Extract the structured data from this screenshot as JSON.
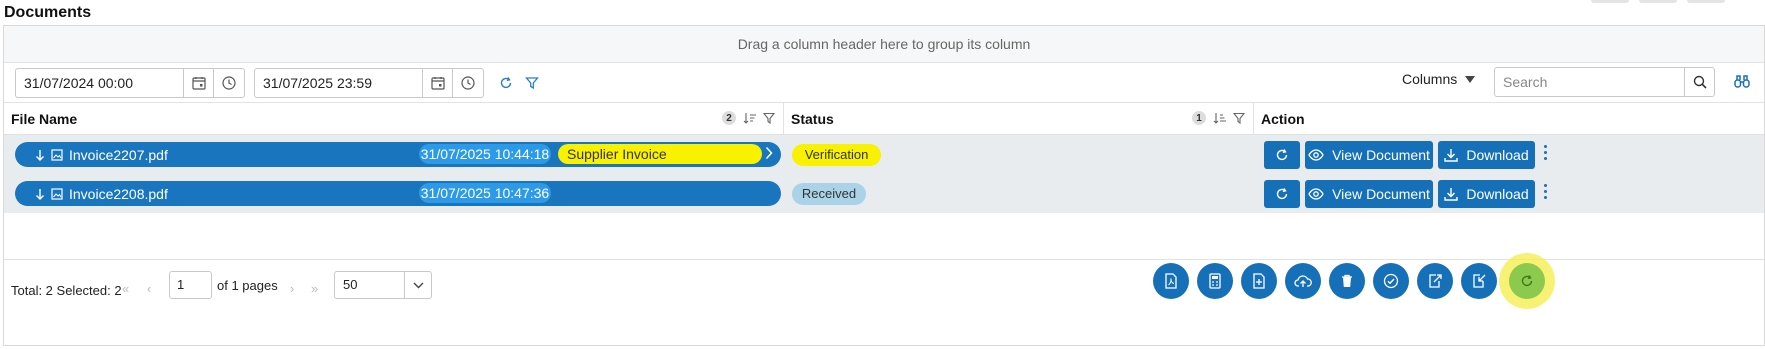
{
  "page": {
    "title": "Documents"
  },
  "group_panel": {
    "text": "Drag a column header here to group its column"
  },
  "toolbar": {
    "date_from": "31/07/2024 00:00",
    "date_to": "31/07/2025 23:59",
    "columns_label": "Columns",
    "search_placeholder": "Search"
  },
  "columns": [
    {
      "label": "File Name",
      "sort_order": "2"
    },
    {
      "label": "Status",
      "sort_order": "1"
    },
    {
      "label": "Action"
    }
  ],
  "rows": [
    {
      "file_name": "Invoice2207.pdf",
      "timestamp": "31/07/2025 10:44:18",
      "tag": "Supplier Invoice",
      "status": "Verification"
    },
    {
      "file_name": "Invoice2208.pdf",
      "timestamp": "31/07/2025 10:47:36",
      "tag": "",
      "status": "Received"
    }
  ],
  "actions": {
    "view_label": "View Document",
    "download_label": "Download"
  },
  "footer": {
    "total_text": "Total: 2 Selected: 2",
    "page_value": "1",
    "of_pages_text": "of 1 pages",
    "page_size": "50"
  },
  "colors": {
    "primary": "#1670b8",
    "file_pill": "#1976be",
    "timestamp": "#2c9ae6",
    "highlight": "#f8f100",
    "received": "#aad3e8",
    "refresh_green": "#8cc94f"
  },
  "bottom_actions": [
    "pdf-icon",
    "calculator-icon",
    "file-plus-icon",
    "cloud-upload-icon",
    "trash-icon",
    "check-circle-icon",
    "export-icon",
    "import-icon",
    "refresh-icon"
  ]
}
